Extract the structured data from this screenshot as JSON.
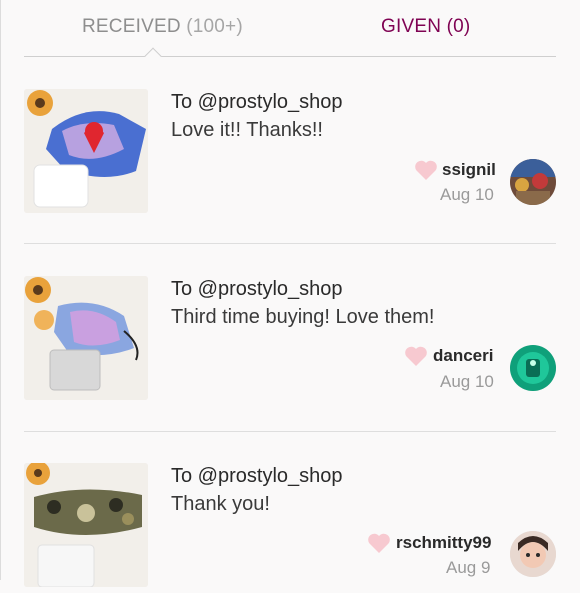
{
  "tabs": {
    "received_label": "RECEIVED",
    "received_count": "(100+)",
    "given_label": "GIVEN (0)"
  },
  "reviews": [
    {
      "to": "To @prostylo_shop",
      "message": "Love it!! Thanks!!",
      "username": "ssignil",
      "date": "Aug 10"
    },
    {
      "to": "To @prostylo_shop",
      "message": "Third time buying! Love them!",
      "username": "danceri",
      "date": "Aug 10"
    },
    {
      "to": "To @prostylo_shop",
      "message": "Thank you!",
      "username": "rschmitty99",
      "date": "Aug 9"
    }
  ],
  "colors": {
    "given_tab": "#7f0353",
    "heart": "#f7c9d0",
    "divider": "#dedede"
  },
  "icons": [
    "heart-icon",
    "product-thumbnail",
    "user-avatar"
  ]
}
